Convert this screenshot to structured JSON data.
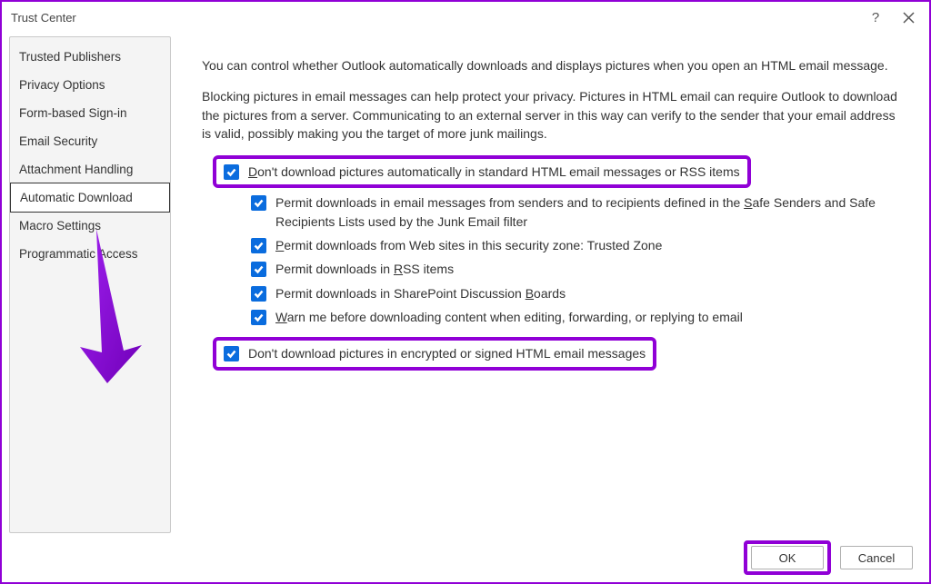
{
  "window": {
    "title": "Trust Center"
  },
  "sidebar": {
    "items": [
      {
        "label": "Trusted Publishers"
      },
      {
        "label": "Privacy Options"
      },
      {
        "label": "Form-based Sign-in"
      },
      {
        "label": "Email Security"
      },
      {
        "label": "Attachment Handling"
      },
      {
        "label": "Automatic Download",
        "selected": true
      },
      {
        "label": "Macro Settings"
      },
      {
        "label": "Programmatic Access"
      }
    ]
  },
  "content": {
    "intro1": "You can control whether Outlook automatically downloads and displays pictures when you open an HTML email message.",
    "intro2": "Blocking pictures in email messages can help protect your privacy. Pictures in HTML email can require Outlook to download the pictures from a server. Communicating to an external server in this way can verify to the sender that your email address is valid, possibly making you the target of more junk mailings.",
    "opt1": {
      "pre": "D",
      "rest": "on't download pictures automatically in standard HTML email messages or RSS items",
      "checked": true
    },
    "sub": [
      {
        "pre": "S",
        "rest": "afe Senders and Safe Recipients Lists used by the Junk Email filter",
        "prefix": "Permit downloads in email messages from senders and to recipients defined in the ",
        "checked": true
      },
      {
        "pre": "P",
        "rest": "ermit downloads from Web sites in this security zone: Trusted Zone",
        "checked": true
      },
      {
        "pre": "R",
        "rest": "SS items",
        "prefix": "Permit downloads in ",
        "checked": true
      },
      {
        "pre": "B",
        "rest": "oards",
        "prefix": "Permit downloads in SharePoint Discussion ",
        "checked": true
      },
      {
        "pre": "W",
        "rest": "arn me before downloading content when editing, forwarding, or replying to email",
        "checked": true
      }
    ],
    "opt2": {
      "label": "Don't download pictures in encrypted or signed HTML email messages",
      "checked": true
    }
  },
  "footer": {
    "ok": "OK",
    "cancel": "Cancel"
  }
}
